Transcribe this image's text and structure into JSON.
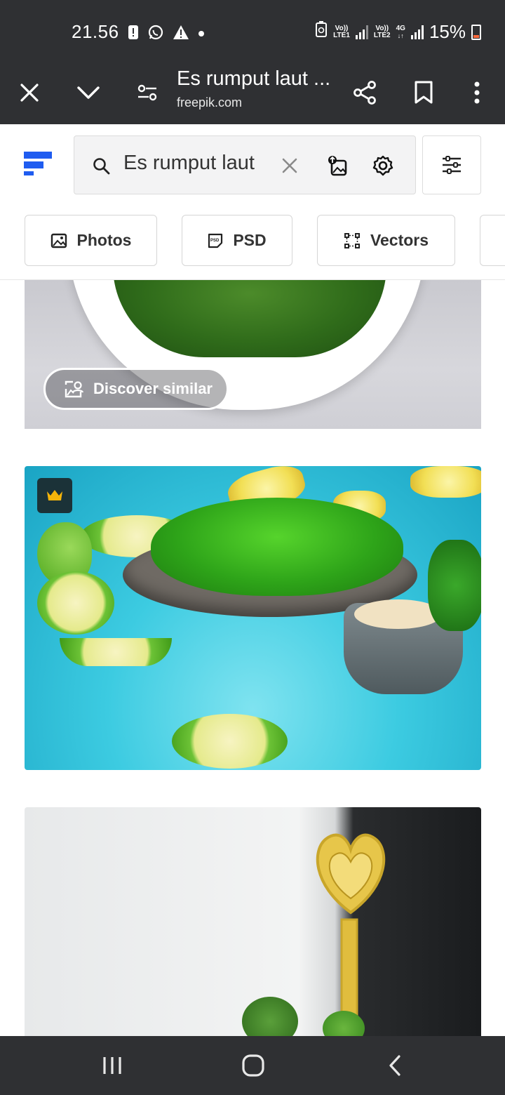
{
  "status_bar": {
    "time": "21.56",
    "battery": "15%",
    "sim1": {
      "top": "Vo))",
      "bottom": "LTE1"
    },
    "sim2": {
      "top": "Vo))",
      "bottom": "LTE2"
    },
    "net_type": "4G",
    "icons": [
      "alert-icon",
      "whatsapp-icon",
      "warning-icon",
      "dot-icon",
      "battery-saver-icon",
      "signal-icon",
      "battery-icon"
    ]
  },
  "browser_toolbar": {
    "title": "Es rumput laut ...",
    "url": "freepik.com",
    "icons": [
      "close-icon",
      "chevron-down-icon",
      "tune-icon",
      "share-icon",
      "bookmark-icon",
      "more-vert-icon"
    ]
  },
  "search": {
    "query": "Es rumput laut",
    "icons": [
      "search-icon",
      "clear-icon",
      "image-search-icon",
      "settings-icon",
      "filter-icon"
    ]
  },
  "chips": [
    {
      "label": "Photos",
      "icon": "photo-icon"
    },
    {
      "label": "PSD",
      "icon": "psd-icon"
    },
    {
      "label": "Vectors",
      "icon": "vector-icon"
    }
  ],
  "results": {
    "discover_label": "Discover similar"
  },
  "colors": {
    "bar_bg": "#2f3033",
    "brand_blue": "#1f5cf0",
    "premium_gold": "#f5b50a"
  }
}
